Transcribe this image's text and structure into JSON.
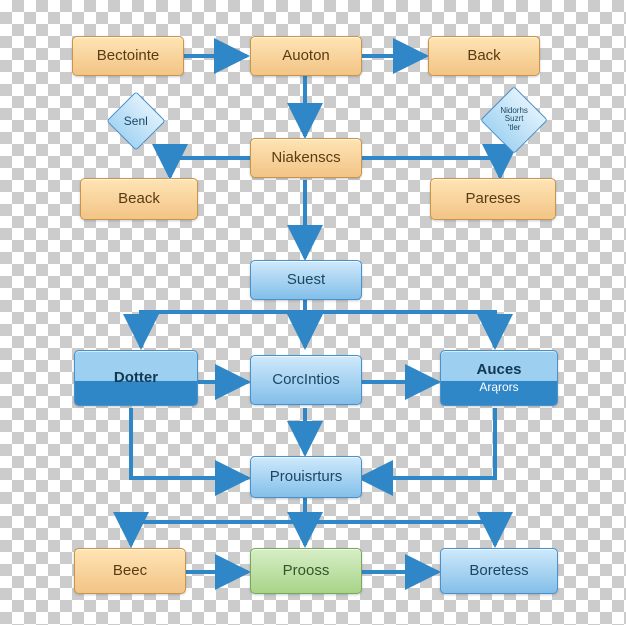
{
  "nodes": {
    "bectointe": "Bectointe",
    "auoton": "Auoton",
    "back": "Back",
    "senl": "Senl",
    "niakenscs": "Niakenscs",
    "noteDiamond": "Nidorhs\nSuzrt\n'tler",
    "beack": "Beack",
    "pareses": "Pareses",
    "suest": "Suest",
    "dotter": "Dotter",
    "corcintios": "CorcIntios",
    "auces": "Auces",
    "aucesSub": "Arąrors",
    "prouisrturs": "Prouisrturs",
    "beec": "Beec",
    "prooss": "Prooss",
    "boretess": "Boretess"
  },
  "colors": {
    "arrow": "#2f87c7"
  }
}
